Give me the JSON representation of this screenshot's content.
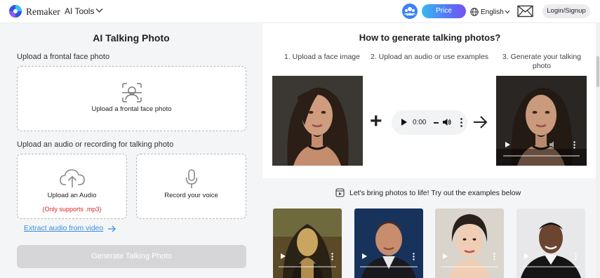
{
  "header": {
    "brand": "Remaker",
    "ai_tools": "AI Tools",
    "price": "Price",
    "language": "English",
    "login": "Login/Signup"
  },
  "left": {
    "title": "AI Talking Photo",
    "upload_photo_heading": "Upload a frontal face photo",
    "upload_photo_box": "Upload a frontal face photo",
    "upload_audio_heading": "Upload an audio or recording for talking photo",
    "upload_audio_box": "Upload an Audio",
    "upload_audio_note": "(Only supports .mp3)",
    "record_box": "Record your voice",
    "extract_link": "Extract audio from video",
    "generate_button": "Generate Talking Photo"
  },
  "how_to": {
    "title": "How to generate talking photos?",
    "steps": [
      "1. Upload a face image",
      "2. Upload an audio or use examples",
      "3. Generate your talking photo"
    ],
    "audio_time": "0:00"
  },
  "examples": {
    "label": "Let's bring photos to life! Try out the examples below",
    "items": [
      "mona-lisa",
      "arnold",
      "audrey",
      "will"
    ]
  },
  "colors": {
    "accent_start": "#38b8f0",
    "accent_end": "#7b52f0",
    "link": "#3b8ed8",
    "warning": "#e02424",
    "panel_bg": "#f4f5f7"
  }
}
